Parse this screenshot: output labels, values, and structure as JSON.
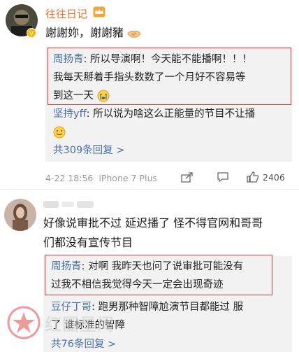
{
  "comment1": {
    "username": "往往日记",
    "text": "謝謝妳，謝謝豬",
    "replies": [
      {
        "user": "周扬青",
        "text_line1": ": 所以导演啊！今天能不能播啊！！！",
        "text_line2": "我每天掰着手指头数数了一个月好不容易等",
        "text_line3": "到这一天"
      },
      {
        "user": "坚持yff",
        "text_line1": ": 所以说为啥这么正能量的节目不让播"
      }
    ],
    "more_replies": "共309条回复 >",
    "timestamp": "4-22 18:56",
    "device": "iPhone 7 Plus",
    "like_count": "2406"
  },
  "comment2": {
    "text_line1": "好像说审批不过  延迟播了  怪不得官网和哥哥",
    "text_line2": "们都没有宣传节目",
    "replies": [
      {
        "user": "周扬青",
        "text_line1": ": 对啊 我昨天也问了说审批可能没有",
        "text_line2": "过我不相信我觉得今天一定会出现奇迹"
      },
      {
        "user": "豆仔丁哥",
        "text_line1": ": 跑男那种智障尬演节目都能过  服",
        "text_line2": "了  谁标准的智障"
      }
    ],
    "more_replies": "共76条回复 >"
  },
  "watermark": "红圈星闻",
  "colors": {
    "link": "#4a6fa5",
    "highlight": "#d43a3a",
    "reply_bg": "#f2f2f2"
  }
}
